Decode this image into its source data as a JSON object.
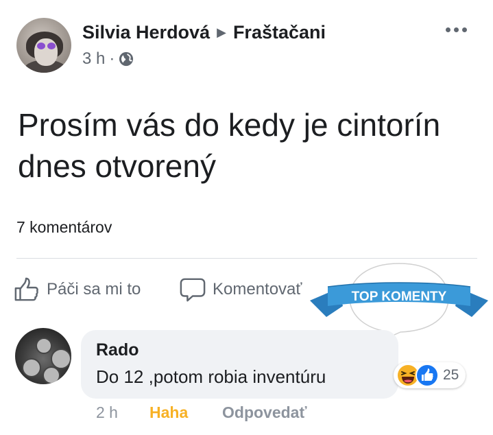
{
  "post": {
    "author": "Silvia Herdová",
    "group": "Fraštačani",
    "time": "3 h",
    "text_line1": "Prosím vás do kedy je cintorín",
    "text_line2": "dnes otvorený",
    "comment_count": "7 komentárov"
  },
  "actions": {
    "like_label": "Páči sa mi to",
    "comment_label": "Komentovať"
  },
  "badge": {
    "label": "TOP KOMENTY",
    "ribbon_color": "#3b9ad9"
  },
  "comment": {
    "author": "Rado",
    "text": "Do 12 ,potom robia inventúru",
    "reaction_count": "25",
    "reactions": [
      "haha-emoji-icon",
      "like-emoji-icon"
    ],
    "time": "2 h",
    "haha_label": "Haha",
    "reply_label": "Odpovedať"
  },
  "colors": {
    "text_primary": "#1c1e21",
    "text_secondary": "#606770",
    "haha_accent": "#f7b125",
    "like_blue": "#1877f2"
  }
}
